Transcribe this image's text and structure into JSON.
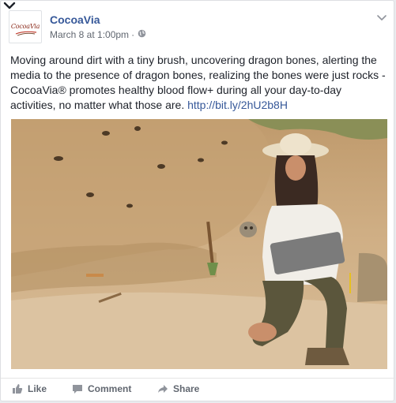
{
  "post": {
    "page_name": "CocoaVia",
    "avatar_logo_text": "CocoaVia",
    "timestamp": "March 8 at 1:00pm",
    "separator": "·",
    "audience_icon": "globe-icon",
    "body_text": "Moving around dirt with a tiny brush, uncovering dragon bones, alerting the media to the presence of dragon bones, realizing the bones were just rocks - CocoaVia® promotes healthy blood flow+ during all your day-to-day activities, no matter what those are.",
    "link": "http://bit.ly/2hU2b8H"
  },
  "actions": {
    "like_label": "Like",
    "comment_label": "Comment",
    "share_label": "Share"
  },
  "colors": {
    "link": "#365899",
    "meta": "#616770",
    "text": "#1d2129"
  }
}
